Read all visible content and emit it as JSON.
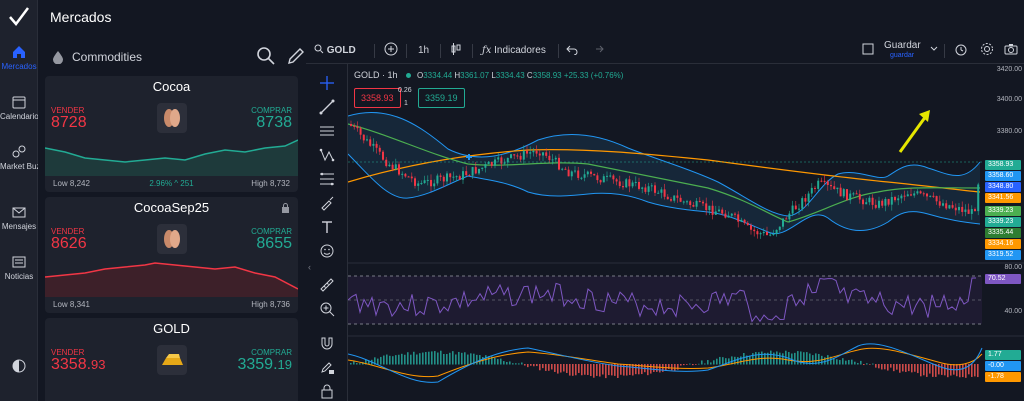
{
  "colors": {
    "up": "#22ab94",
    "down": "#f23645",
    "accent": "#2962ff",
    "bg": "#131722",
    "panel": "#1e222d"
  },
  "rail": {
    "logo": "checkmark-logo",
    "items": [
      {
        "label": "Mercados",
        "icon": "home-icon",
        "active": true
      },
      {
        "label": "Calendario",
        "icon": "calendar-icon"
      },
      {
        "label": "Market Buzz",
        "icon": "bubbles-icon"
      },
      {
        "label": "Mensajes",
        "icon": "mail-icon"
      },
      {
        "label": "Noticias",
        "icon": "news-icon"
      }
    ],
    "bottom_icon": "contrast-icon"
  },
  "panel": {
    "title": "Mercados",
    "category": "Commodities",
    "cards": [
      {
        "name": "Cocoa",
        "sell_label": "VENDER",
        "sell": "8728",
        "buy_label": "COMPRAR",
        "buy": "8738",
        "low": "Low 8,242",
        "high": "High 8,732",
        "change": "2.96% ^ 251",
        "trend": "up"
      },
      {
        "name": "CocoaSep25",
        "sell_label": "VENDER",
        "sell": "8626",
        "buy_label": "COMPRAR",
        "buy": "8655",
        "low": "Low 8,341",
        "high": "High 8,736",
        "change": "",
        "trend": "down",
        "locked": true
      },
      {
        "name": "GOLD",
        "sell_label": "VENDER",
        "sell_main": "3358.",
        "sell_small": "93",
        "buy_label": "COMPRAR",
        "buy_main": "3359.",
        "buy_small": "19",
        "trend": "up"
      }
    ]
  },
  "toolbar": {
    "symbol": "GOLD",
    "interval": "1h",
    "indicators": "Indicadores",
    "save": "Guardar",
    "save_sub": "guardar"
  },
  "legend": {
    "title": "GOLD · 1h",
    "o_label": "O",
    "o": "3334.44",
    "h_label": "H",
    "h": "3361.07",
    "l_label": "L",
    "l": "3334.43",
    "c_label": "C",
    "c": "3358.93",
    "change": "+25.33 (+0.76%)",
    "sell_box": "3358.93",
    "spread": "0.26",
    "qty": "1",
    "buy_box": "3359.19"
  },
  "price_axis": {
    "labels": [
      "3420.00",
      "3400.00",
      "3380.00"
    ],
    "tags": [
      {
        "value": "3358.93",
        "color": "#22ab94"
      },
      {
        "value": "3358.60",
        "color": "#2196f3"
      },
      {
        "value": "3348.80",
        "color": "#2962ff"
      },
      {
        "value": "3341.56",
        "color": "#ff9800"
      },
      {
        "value": "3339.23",
        "color": "#4caf50"
      },
      {
        "value": "3339.23",
        "color": "#22ab94"
      },
      {
        "value": "3335.44",
        "color": "#2e7d32"
      },
      {
        "value": "3334.16",
        "color": "#ff9800"
      },
      {
        "value": "3319.52",
        "color": "#2196f3"
      }
    ]
  },
  "rsi_axis": {
    "labels": [
      "80.00",
      "40.00"
    ],
    "tag": "70.52"
  },
  "macd_axis": {
    "tags": [
      "1.77",
      "-0.00",
      "-1.78"
    ]
  }
}
